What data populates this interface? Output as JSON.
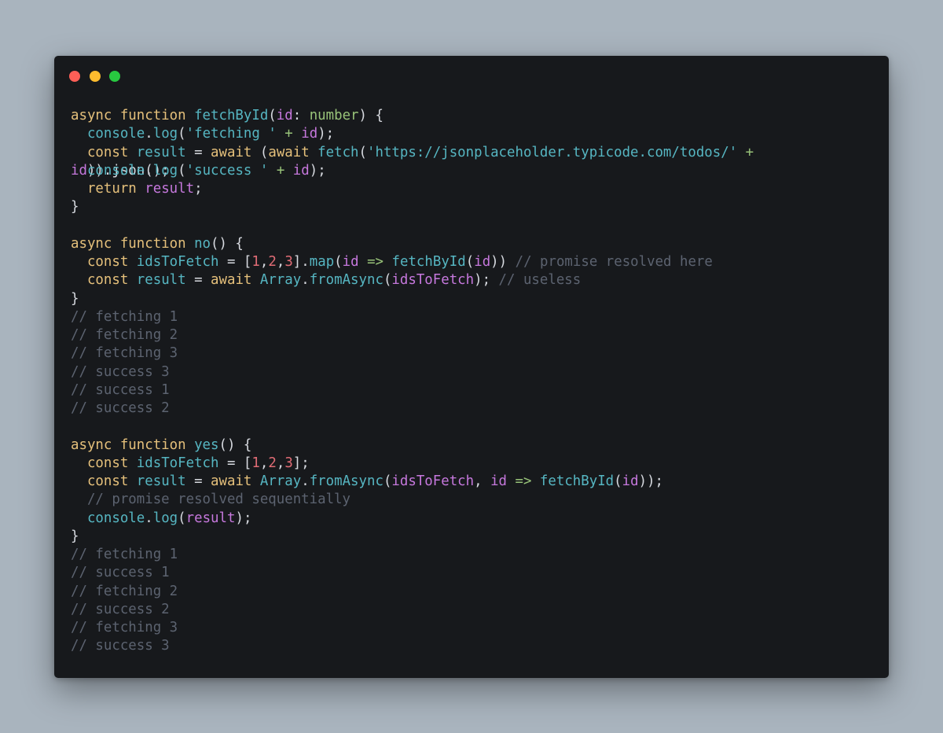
{
  "window": {
    "controls": [
      {
        "name": "close-dot",
        "color": "#ff5f57"
      },
      {
        "name": "minimize-dot",
        "color": "#febc2e"
      },
      {
        "name": "maximize-dot",
        "color": "#28c840"
      }
    ]
  },
  "theme": {
    "background": "#17191c",
    "page_background": "#a9b4be",
    "kw": "#e5c07b",
    "fn": "#56b6c2",
    "param": "#c678dd",
    "type": "#98c379",
    "str": "#56b6c2",
    "num": "#e06c75",
    "op": "#98c379",
    "punc": "#d7dae0",
    "comment": "#5c6370",
    "plain": "#abb2bf"
  },
  "code": {
    "lines": [
      [
        [
          "kw",
          "async "
        ],
        [
          "kw",
          "function "
        ],
        [
          "fn",
          "fetchById"
        ],
        [
          "punc",
          "("
        ],
        [
          "param",
          "id"
        ],
        [
          "punc",
          ": "
        ],
        [
          "type",
          "number"
        ],
        [
          "punc",
          ") {"
        ]
      ],
      {
        "overlap": [
          [
            [
              "plain",
              "  "
            ],
            [
              "fn",
              "console"
            ],
            [
              "punc",
              "."
            ],
            [
              "fn",
              "log"
            ],
            [
              "punc",
              "("
            ],
            [
              "str",
              "'fetching '"
            ],
            [
              "op",
              " + "
            ],
            [
              "param",
              "id"
            ],
            [
              "punc",
              ");"
            ]
          ],
          [
            [
              "plain",
              "  "
            ],
            [
              "kw",
              "const "
            ],
            [
              "fn",
              "result"
            ],
            [
              "punc",
              " = "
            ],
            [
              "kw",
              "await "
            ],
            [
              "punc",
              "("
            ],
            [
              "kw",
              "await "
            ],
            [
              "fn",
              "fetch"
            ],
            [
              "punc",
              "("
            ],
            [
              "str",
              "'https://jsonplaceholder.typicode.com/todos/'"
            ],
            [
              "op",
              " +"
            ]
          ],
          [
            [
              "param",
              "id"
            ],
            [
              "punc",
              ")).json();"
            ]
          ],
          [
            [
              "plain",
              "  "
            ],
            [
              "fn",
              "console"
            ],
            [
              "punc",
              "."
            ],
            [
              "fn",
              "log"
            ],
            [
              "punc",
              "("
            ],
            [
              "str",
              "'success '"
            ],
            [
              "op",
              " + "
            ],
            [
              "param",
              "id"
            ],
            [
              "punc",
              ");"
            ]
          ]
        ]
      },
      [
        [
          "plain",
          "  "
        ],
        [
          "kw",
          "return "
        ],
        [
          "param",
          "result"
        ],
        [
          "punc",
          ";"
        ]
      ],
      [
        [
          "punc",
          "}"
        ]
      ],
      [],
      [
        [
          "kw",
          "async "
        ],
        [
          "kw",
          "function "
        ],
        [
          "fn",
          "no"
        ],
        [
          "punc",
          "() {"
        ]
      ],
      [
        [
          "plain",
          "  "
        ],
        [
          "kw",
          "const "
        ],
        [
          "fn",
          "idsToFetch"
        ],
        [
          "punc",
          " = ["
        ],
        [
          "num",
          "1"
        ],
        [
          "punc",
          ","
        ],
        [
          "num",
          "2"
        ],
        [
          "punc",
          ","
        ],
        [
          "num",
          "3"
        ],
        [
          "punc",
          "]."
        ],
        [
          "fn",
          "map"
        ],
        [
          "punc",
          "("
        ],
        [
          "param",
          "id"
        ],
        [
          "op",
          " => "
        ],
        [
          "fn",
          "fetchById"
        ],
        [
          "punc",
          "("
        ],
        [
          "param",
          "id"
        ],
        [
          "punc",
          "))"
        ],
        [
          "comment",
          " // promise resolved here"
        ]
      ],
      [
        [
          "plain",
          "  "
        ],
        [
          "kw",
          "const "
        ],
        [
          "fn",
          "result"
        ],
        [
          "punc",
          " = "
        ],
        [
          "kw",
          "await "
        ],
        [
          "fn",
          "Array"
        ],
        [
          "punc",
          "."
        ],
        [
          "fn",
          "fromAsync"
        ],
        [
          "punc",
          "("
        ],
        [
          "param",
          "idsToFetch"
        ],
        [
          "punc",
          ");"
        ],
        [
          "comment",
          " // useless"
        ]
      ],
      [
        [
          "punc",
          "}"
        ]
      ],
      [
        [
          "comment",
          "// fetching 1"
        ]
      ],
      [
        [
          "comment",
          "// fetching 2"
        ]
      ],
      [
        [
          "comment",
          "// fetching 3"
        ]
      ],
      [
        [
          "comment",
          "// success 3"
        ]
      ],
      [
        [
          "comment",
          "// success 1"
        ]
      ],
      [
        [
          "comment",
          "// success 2"
        ]
      ],
      [],
      [
        [
          "kw",
          "async "
        ],
        [
          "kw",
          "function "
        ],
        [
          "fn",
          "yes"
        ],
        [
          "punc",
          "() {"
        ]
      ],
      [
        [
          "plain",
          "  "
        ],
        [
          "kw",
          "const "
        ],
        [
          "fn",
          "idsToFetch"
        ],
        [
          "punc",
          " = ["
        ],
        [
          "num",
          "1"
        ],
        [
          "punc",
          ","
        ],
        [
          "num",
          "2"
        ],
        [
          "punc",
          ","
        ],
        [
          "num",
          "3"
        ],
        [
          "punc",
          "];"
        ]
      ],
      [
        [
          "plain",
          "  "
        ],
        [
          "kw",
          "const "
        ],
        [
          "fn",
          "result"
        ],
        [
          "punc",
          " = "
        ],
        [
          "kw",
          "await "
        ],
        [
          "fn",
          "Array"
        ],
        [
          "punc",
          "."
        ],
        [
          "fn",
          "fromAsync"
        ],
        [
          "punc",
          "("
        ],
        [
          "param",
          "idsToFetch"
        ],
        [
          "punc",
          ", "
        ],
        [
          "param",
          "id"
        ],
        [
          "op",
          " => "
        ],
        [
          "fn",
          "fetchById"
        ],
        [
          "punc",
          "("
        ],
        [
          "param",
          "id"
        ],
        [
          "punc",
          "));"
        ]
      ],
      [
        [
          "plain",
          "  "
        ],
        [
          "comment",
          "// promise resolved sequentially"
        ]
      ],
      [
        [
          "plain",
          "  "
        ],
        [
          "fn",
          "console"
        ],
        [
          "punc",
          "."
        ],
        [
          "fn",
          "log"
        ],
        [
          "punc",
          "("
        ],
        [
          "param",
          "result"
        ],
        [
          "punc",
          ");"
        ]
      ],
      [
        [
          "punc",
          "}"
        ]
      ],
      [
        [
          "comment",
          "// fetching 1"
        ]
      ],
      [
        [
          "comment",
          "// success 1"
        ]
      ],
      [
        [
          "comment",
          "// fetching 2"
        ]
      ],
      [
        [
          "comment",
          "// success 2"
        ]
      ],
      [
        [
          "comment",
          "// fetching 3"
        ]
      ],
      [
        [
          "comment",
          "// success 3"
        ]
      ]
    ]
  }
}
